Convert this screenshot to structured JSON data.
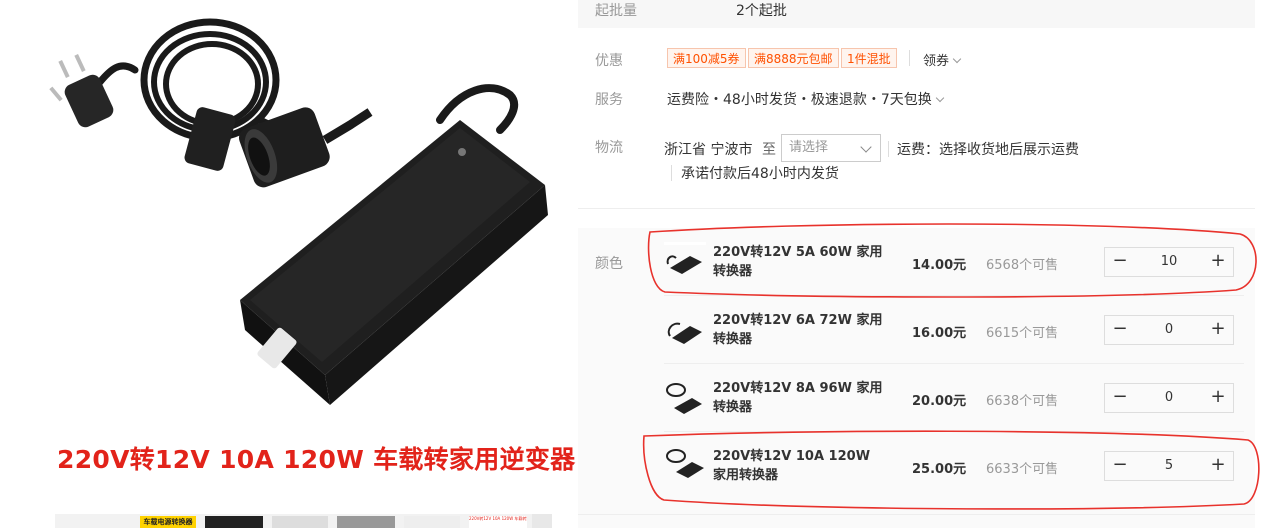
{
  "gallery": {
    "caption": "220V转12V 10A 120W 车载转家用逆变器",
    "thumb_labels": [
      "车载电源转换器",
      "220V转12V 10A 120W 车载转家用逆变器"
    ]
  },
  "details": {
    "min_order": {
      "label": "起批量",
      "value": "2个起批"
    },
    "promotion": {
      "label": "优惠",
      "tags": [
        "满100减5券",
        "满8888元包邮",
        "1件混批"
      ],
      "coupon_link": "领券"
    },
    "service": {
      "label": "服务",
      "value": "运费险・48小时发货・极速退款・7天包换"
    },
    "logistics": {
      "label": "物流",
      "origin": "浙江省 宁波市",
      "to": "至",
      "select_placeholder": "请选择",
      "shipping_fee": "运费：选择收货地后展示运费",
      "promise": "承诺付款后48小时内发货"
    }
  },
  "sku": {
    "label": "颜色",
    "items": [
      {
        "name": "220V转12V 5A 60W 家用转换器",
        "price": "14.00元",
        "stock": "6568个可售",
        "qty": "10"
      },
      {
        "name": "220V转12V 6A 72W 家用转换器",
        "price": "16.00元",
        "stock": "6615个可售",
        "qty": "0"
      },
      {
        "name": "220V转12V 8A 96W 家用转换器",
        "price": "20.00元",
        "stock": "6638个可售",
        "qty": "0"
      },
      {
        "name": "220V转12V 10A 120W 家用转换器",
        "price": "25.00元",
        "stock": "6633个可售",
        "qty": "5"
      }
    ],
    "minus": "−",
    "plus": "+"
  },
  "colors": {
    "accent": "#ff5000",
    "caption_red": "#e2231a",
    "annotation_red": "#e8322c"
  }
}
